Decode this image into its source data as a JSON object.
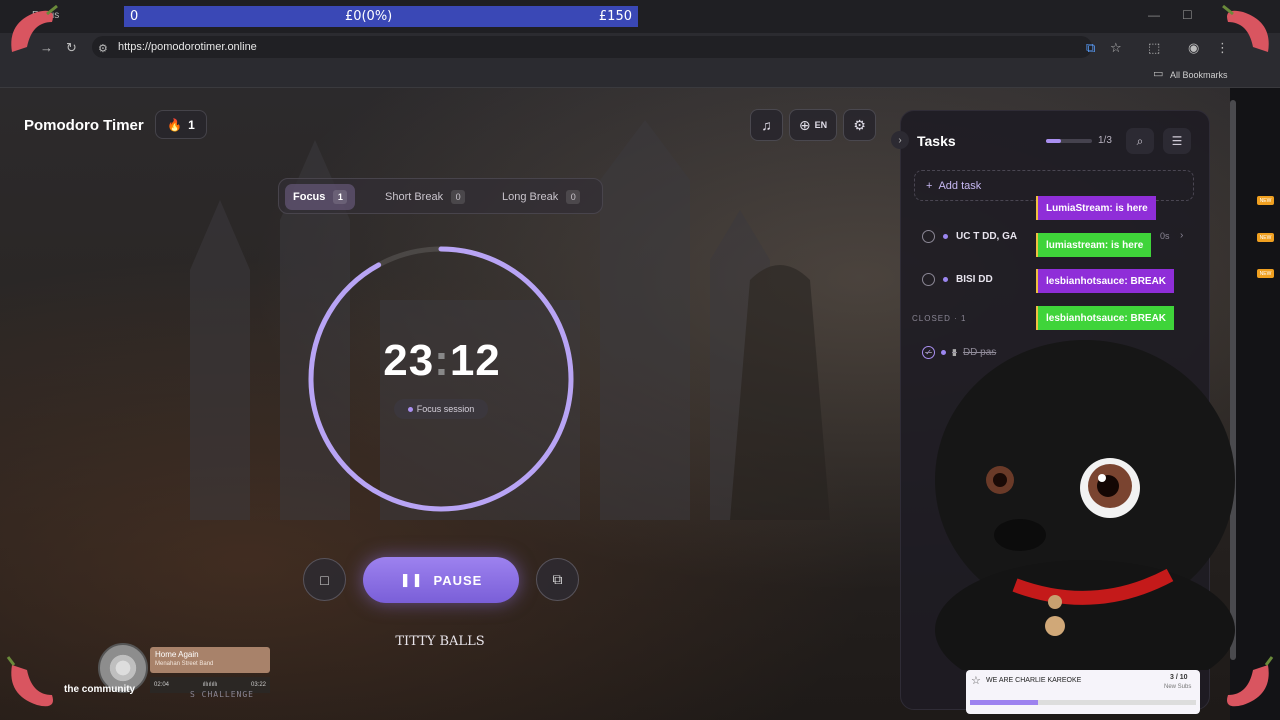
{
  "browser": {
    "tab_label": "Focus",
    "url": "https://pomodorotimer.online",
    "all_bookmarks": "All Bookmarks"
  },
  "donation_goal": {
    "start": "0",
    "current": "£0(0%)",
    "target": "£150"
  },
  "app": {
    "title": "Pomodoro Timer",
    "streak_count": "1",
    "language": "EN"
  },
  "modes": [
    {
      "label": "Focus",
      "count": "1",
      "active": true
    },
    {
      "label": "Short Break",
      "count": "0",
      "active": false
    },
    {
      "label": "Long Break",
      "count": "0",
      "active": false
    }
  ],
  "timer": {
    "minutes": "23",
    "seconds": "12",
    "session_label": "Focus session",
    "progress": 0.92,
    "ring_color": "#b8a4f5"
  },
  "controls": {
    "pause_label": "PAUSE"
  },
  "caption": "TITTY BALLS",
  "tasks": {
    "title": "Tasks",
    "progress_text": "1/3",
    "progress": 0.33,
    "add_label": "Add task",
    "items": [
      {
        "name": "UC T DD, GA"
      },
      {
        "name": "BISI DD"
      }
    ],
    "closed_label": "CLOSED · 1",
    "closed_items": [
      {
        "name": "DD pas"
      }
    ],
    "elapsed": "0s"
  },
  "chat": [
    {
      "text": "LumiaStream: is here",
      "color": "purple"
    },
    {
      "text": "lumiastream: is here",
      "color": "green"
    },
    {
      "text": "lesbianhotsauce: BREAK",
      "color": "purple"
    },
    {
      "text": "lesbianhotsauce: BREAK",
      "color": "green"
    }
  ],
  "sub_goal": {
    "title": "WE ARE CHARLIE KAREOKE",
    "count": "3 / 10",
    "subtitle": "New Subs",
    "progress": 0.3
  },
  "music": {
    "title": "Home Again",
    "artist": "Menahan Street Band",
    "elapsed": "02:04",
    "duration": "03:22"
  },
  "overlay": {
    "community": "the community",
    "challenge": "S CHALLENGE",
    "new_badge": "NEW"
  },
  "colors": {
    "accent": "#9d82ef",
    "chat_purple": "#8f2ed8",
    "chat_green": "#3fd43a"
  }
}
